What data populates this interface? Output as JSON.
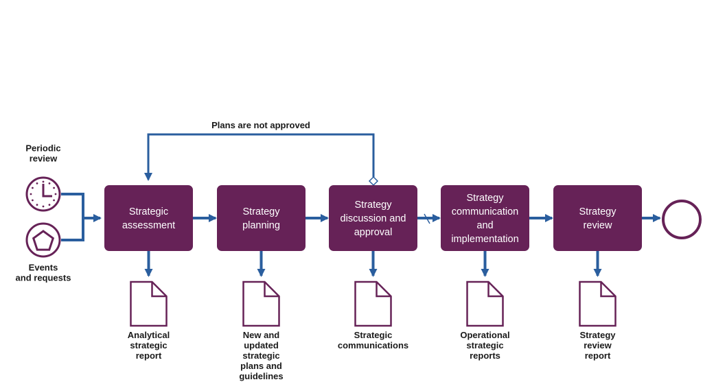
{
  "colors": {
    "process": "#662257",
    "flow": "#2a5e9e",
    "outline": "#662257",
    "text": "#1a1a1a"
  },
  "loop_label": "Plans are not approved",
  "start_events": [
    {
      "id": "timer",
      "icon": "clock-icon",
      "label": [
        "Periodic",
        "review"
      ]
    },
    {
      "id": "signal",
      "icon": "pentagon-icon",
      "label": [
        "Events",
        "and requests"
      ]
    }
  ],
  "processes": [
    {
      "label": [
        "Strategic",
        "assessment"
      ],
      "output": [
        "Analytical",
        "strategic",
        "report"
      ]
    },
    {
      "label": [
        "Strategy",
        "planning"
      ],
      "output": [
        "New and",
        "updated",
        "strategic",
        "plans and",
        "guidelines"
      ]
    },
    {
      "label": [
        "Strategy",
        "discussion and",
        "approval"
      ],
      "output": [
        "Strategic",
        "communications"
      ]
    },
    {
      "label": [
        "Strategy",
        "communication",
        "and",
        "implementation"
      ],
      "output": [
        "Operational",
        "strategic",
        "reports"
      ]
    },
    {
      "label": [
        "Strategy",
        "review"
      ],
      "output": [
        "Strategy",
        "review",
        "report"
      ]
    }
  ],
  "end_event": {
    "icon": "end-event-circle-icon"
  }
}
